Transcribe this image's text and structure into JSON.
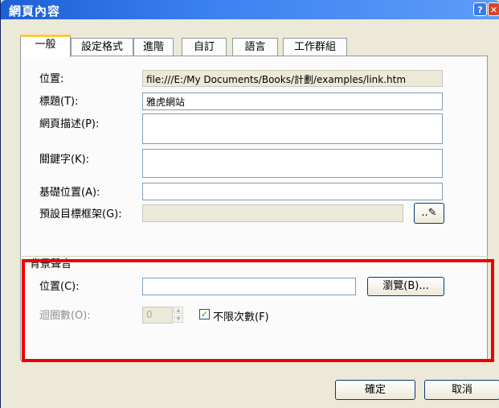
{
  "window": {
    "title": "網頁內容"
  },
  "titlebar": {
    "help_glyph": "?",
    "close_glyph": "✕"
  },
  "tabs": [
    {
      "label": "一般",
      "active": true
    },
    {
      "label": "設定格式"
    },
    {
      "label": "進階"
    },
    {
      "label": "自訂"
    },
    {
      "label": "語言"
    },
    {
      "label": "工作群組"
    }
  ],
  "general": {
    "location": {
      "label": "位置:",
      "value": "file:///E:/My Documents/Books/計劃/examples/link.htm"
    },
    "title": {
      "label": "標題(T):",
      "value": "雅虎網站"
    },
    "description": {
      "label": "網頁描述(P):",
      "value": ""
    },
    "keywords": {
      "label": "關鍵字(K):",
      "value": ""
    },
    "base_location": {
      "label": "基礎位置(A):",
      "value": ""
    },
    "default_target": {
      "label": "預設目標框架(G):",
      "value": "",
      "button_glyph": "..✎"
    }
  },
  "background_sound": {
    "heading": "背景聲音",
    "location": {
      "label": "位置(C):",
      "value": "",
      "browse_label": "瀏覽(B)..."
    },
    "loop": {
      "label": "迴圈數(O):",
      "value": "0",
      "forever_label": "不限次數(F)",
      "forever_checked": true
    }
  },
  "footer": {
    "ok_label": "確定",
    "cancel_label": "取消"
  },
  "colors": {
    "highlight": "#ee0000",
    "title_bar": "#3a80f0",
    "tab_accent": "#ffc83c"
  }
}
